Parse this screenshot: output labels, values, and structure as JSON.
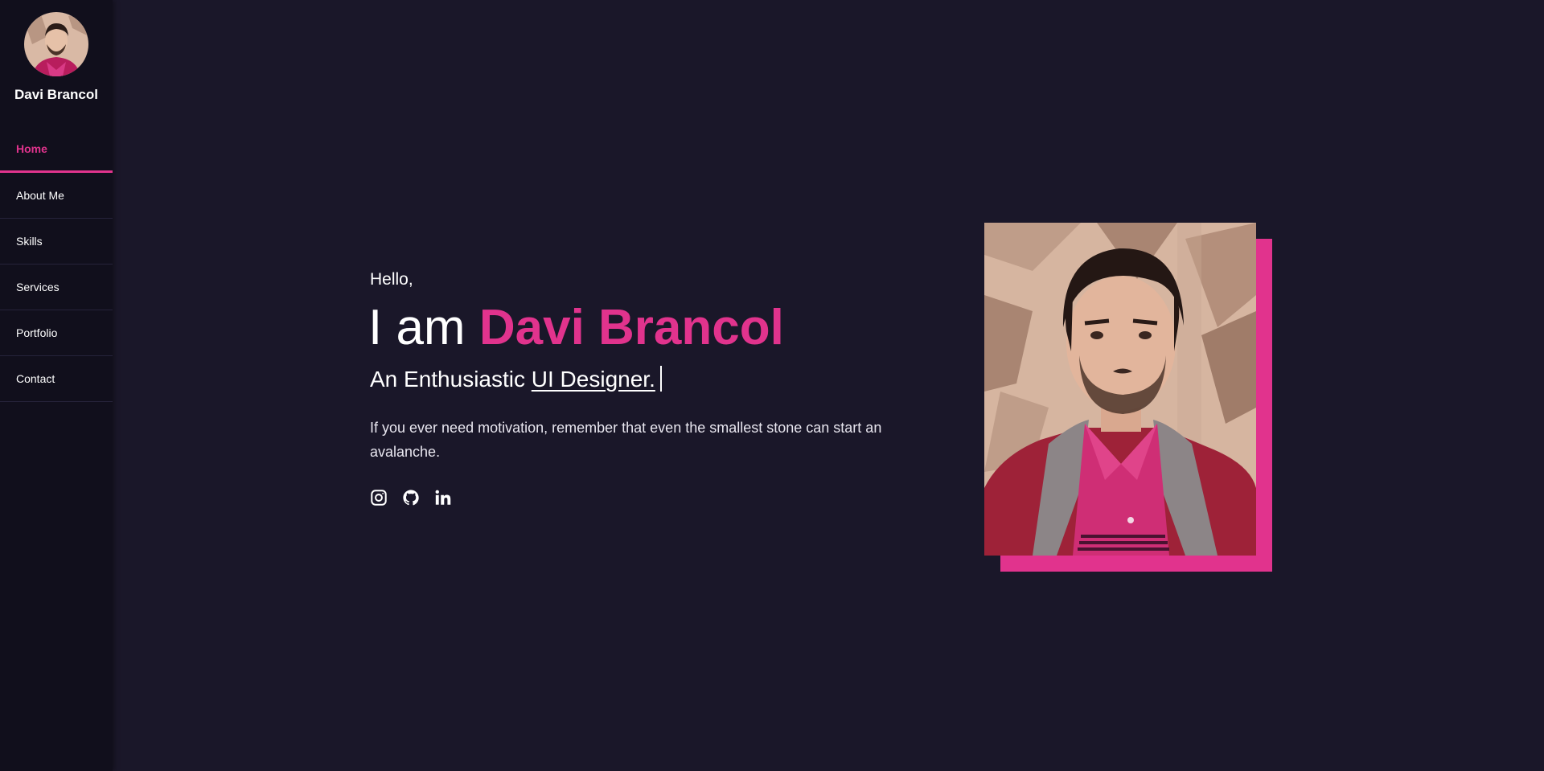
{
  "sidebar": {
    "brand": "Davi Brancol",
    "items": [
      {
        "label": "Home",
        "active": true
      },
      {
        "label": "About Me",
        "active": false
      },
      {
        "label": "Skills",
        "active": false
      },
      {
        "label": "Services",
        "active": false
      },
      {
        "label": "Portfolio",
        "active": false
      },
      {
        "label": "Contact",
        "active": false
      }
    ]
  },
  "hero": {
    "greeting": "Hello,",
    "intro": "I am",
    "name": "Davi Brancol",
    "subtitle_prefix": "An Enthusiastic",
    "role": "UI Designer.",
    "quote": "If you ever need motivation, remember that even the smallest stone can start an avalanche.",
    "socials": [
      {
        "icon": "instagram-icon"
      },
      {
        "icon": "github-icon"
      },
      {
        "icon": "linkedin-icon"
      }
    ]
  },
  "colors": {
    "background": "#1a1729",
    "sidebar": "#110f1c",
    "accent": "#e1338d",
    "text": "#ffffff"
  }
}
